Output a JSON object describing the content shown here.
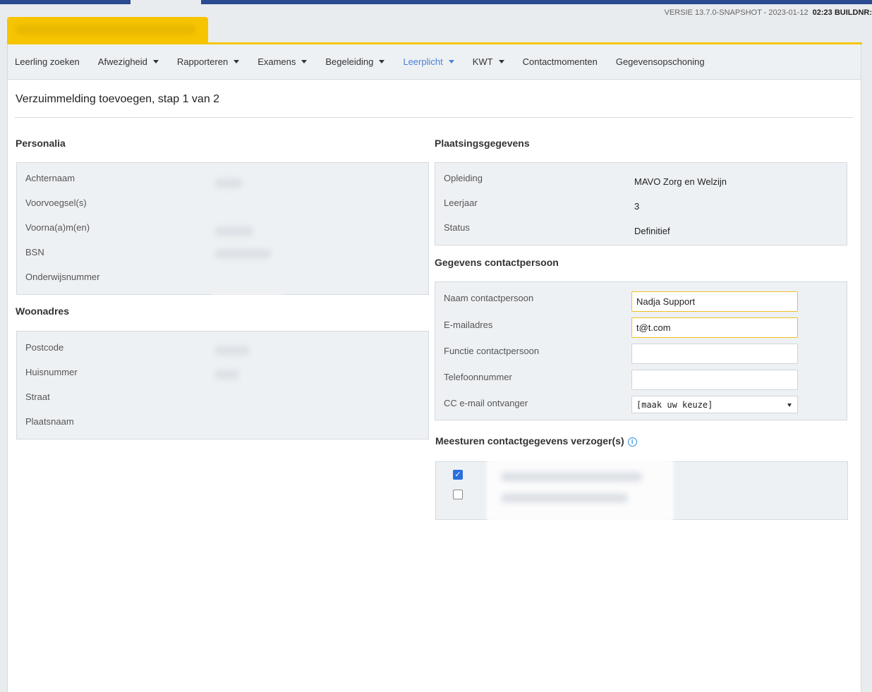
{
  "header": {
    "version": "VERSIE 13.7.0-SNAPSHOT - 2023-01-12",
    "build": "02:23 BUILDNR:"
  },
  "nav": {
    "items": [
      {
        "label": "Leerling zoeken",
        "dropdown": false
      },
      {
        "label": "Afwezigheid",
        "dropdown": true
      },
      {
        "label": "Rapporteren",
        "dropdown": true
      },
      {
        "label": "Examens",
        "dropdown": true
      },
      {
        "label": "Begeleiding",
        "dropdown": true
      },
      {
        "label": "Leerplicht",
        "dropdown": true,
        "active": true
      },
      {
        "label": "KWT",
        "dropdown": true
      },
      {
        "label": "Contactmomenten",
        "dropdown": false
      },
      {
        "label": "Gegevensopschoning",
        "dropdown": false
      }
    ],
    "active_color": "#4a7fd6"
  },
  "page": {
    "title": "Verzuimmelding toevoegen, stap 1 van 2"
  },
  "personalia": {
    "title": "Personalia",
    "labels": [
      "Achternaam",
      "Voorvoegsel(s)",
      "Voorna(a)m(en)",
      "BSN",
      "Onderwijsnummer"
    ]
  },
  "woonadres": {
    "title": "Woonadres",
    "labels": [
      "Postcode",
      "Huisnummer",
      "Straat",
      "Plaatsnaam"
    ]
  },
  "plaatsing": {
    "title": "Plaatsingsgegevens",
    "rows": [
      {
        "label": "Opleiding",
        "value": "MAVO Zorg en Welzijn"
      },
      {
        "label": "Leerjaar",
        "value": "3"
      },
      {
        "label": "Status",
        "value": "Definitief"
      }
    ]
  },
  "contact": {
    "title": "Gegevens contactpersoon",
    "naam_label": "Naam contactpersoon",
    "naam_value": "Nadja Support",
    "email_label": "E-mailadres",
    "email_value": "t@t.com",
    "functie_label": "Functie contactpersoon",
    "functie_value": "",
    "telefoon_label": "Telefoonnummer",
    "telefoon_value": "",
    "cc_label": "CC e-mail ontvanger",
    "cc_value": "[maak uw keuze]"
  },
  "verzogers": {
    "title": "Meesturen contactgegevens verzoger(s)",
    "info_glyph": "i",
    "check_glyph": "✓",
    "items": [
      {
        "checked": true
      },
      {
        "checked": false
      }
    ]
  },
  "colors": {
    "accent_yellow": "#f6c400",
    "brand_blue": "#2b4a8f",
    "checkbox_blue": "#2a6fdc"
  }
}
